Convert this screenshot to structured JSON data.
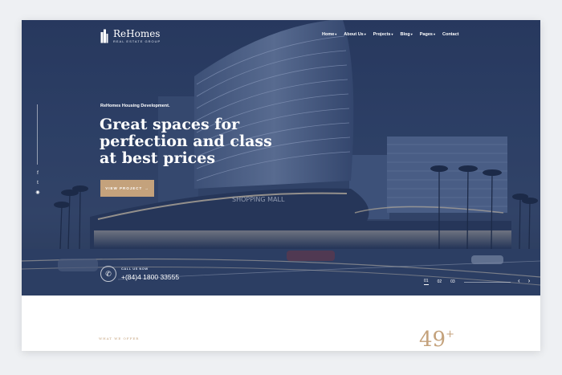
{
  "brand": {
    "name": "ReHomes",
    "subtitle": "REAL ESTATE GROUP"
  },
  "nav": {
    "items": [
      {
        "label": "Home",
        "has_dropdown": true
      },
      {
        "label": "About Us",
        "has_dropdown": true
      },
      {
        "label": "Projects",
        "has_dropdown": true
      },
      {
        "label": "Blog",
        "has_dropdown": true
      },
      {
        "label": "Pages",
        "has_dropdown": true
      },
      {
        "label": "Contact",
        "has_dropdown": false
      }
    ]
  },
  "social": {
    "icons": [
      "facebook-icon",
      "twitter-icon",
      "instagram-icon"
    ]
  },
  "hero": {
    "tagline": "ReHomes Housing Development.",
    "headline_lines": [
      "Great spaces for",
      "perfection and class",
      "at best prices"
    ],
    "cta_label": "VIEW PROJECT",
    "cta_arrow": "→",
    "call_label": "CALL US NOW",
    "phone": "+(84)4 1800 33555",
    "slides": [
      "01",
      "02",
      "03"
    ],
    "active_slide": "01",
    "prev_icon": "‹",
    "next_icon": "›"
  },
  "section": {
    "label": "WHAT WE OFFER",
    "stat_value": "49",
    "stat_suffix": "+"
  },
  "colors": {
    "accent": "#c4a27c",
    "hero_overlay": "#1c2c54"
  }
}
